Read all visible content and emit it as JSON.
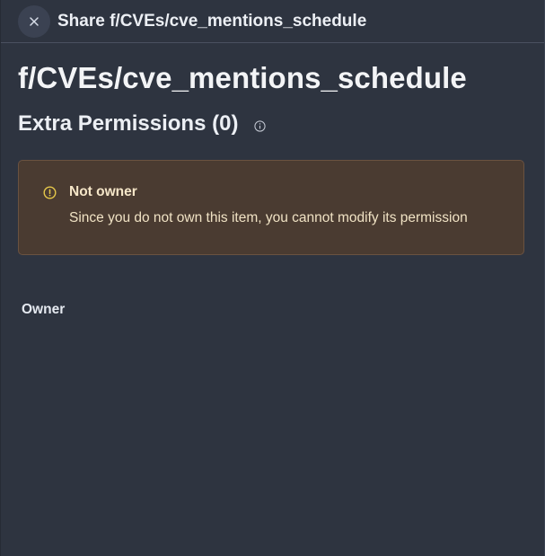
{
  "header": {
    "close_icon": "close-icon",
    "title": "Share f/CVEs/cve_mentions_schedule"
  },
  "main": {
    "page_title": "f/CVEs/cve_mentions_schedule",
    "section_title": "Extra Permissions (0)",
    "info_icon": "info-icon",
    "alert": {
      "icon": "warning-circle-icon",
      "title": "Not owner",
      "body": "Since you do not own this item, you cannot modify its permission",
      "colors": {
        "background": "#4a3b31",
        "border": "#6a5240",
        "icon": "#e6c84a"
      }
    },
    "owner_label": "Owner"
  },
  "colors": {
    "background": "#2e3440",
    "text": "#eceff4"
  }
}
